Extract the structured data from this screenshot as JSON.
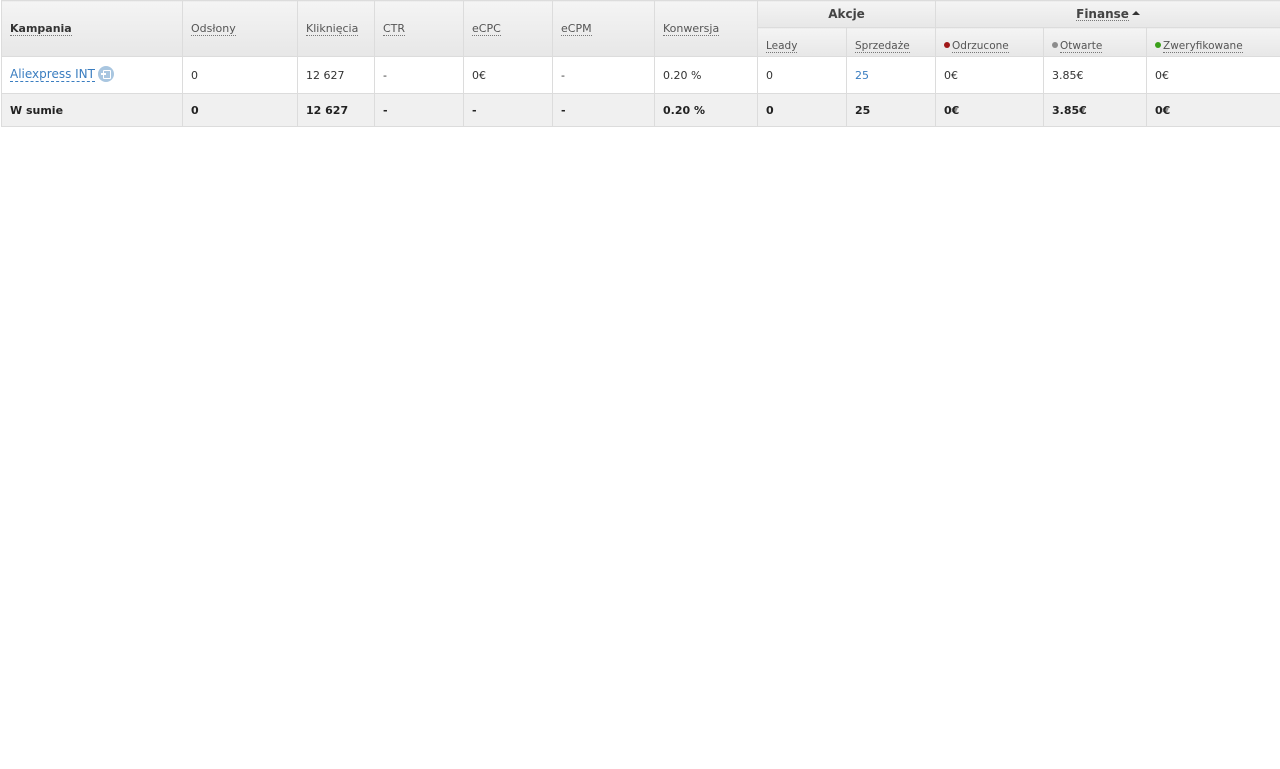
{
  "table": {
    "headers": {
      "campaign": "Kampania",
      "impressions": "Odsłony",
      "clicks": "Kliknięcia",
      "ctr": "CTR",
      "ecpc": "eCPC",
      "ecpm": "eCPM",
      "conversion": "Konwersja",
      "actions_group": "Akcje",
      "leads": "Leady",
      "sales": "Sprzedaże",
      "finance_group": "Finanse",
      "rejected": "Odrzucone",
      "open": "Otwarte",
      "verified": "Zweryfikowane"
    },
    "status_colors": {
      "rejected": "#a01818",
      "open": "#8c8c8c",
      "verified": "#3aa01a"
    },
    "row": {
      "campaign": "Aliexpress INT",
      "impressions": "0",
      "clicks": "12 627",
      "ctr": "-",
      "ecpc": "0€",
      "ecpm": "-",
      "conversion": "0.20 %",
      "leads": "0",
      "sales": "25",
      "rejected": "0€",
      "open": "3.85€",
      "verified": "0€"
    },
    "total": {
      "label": "W sumie",
      "impressions": "0",
      "clicks": "12 627",
      "ctr": "-",
      "ecpc": "-",
      "ecpm": "-",
      "conversion": "0.20 %",
      "leads": "0",
      "sales": "25",
      "rejected": "0€",
      "open": "3.85€",
      "verified": "0€"
    }
  }
}
